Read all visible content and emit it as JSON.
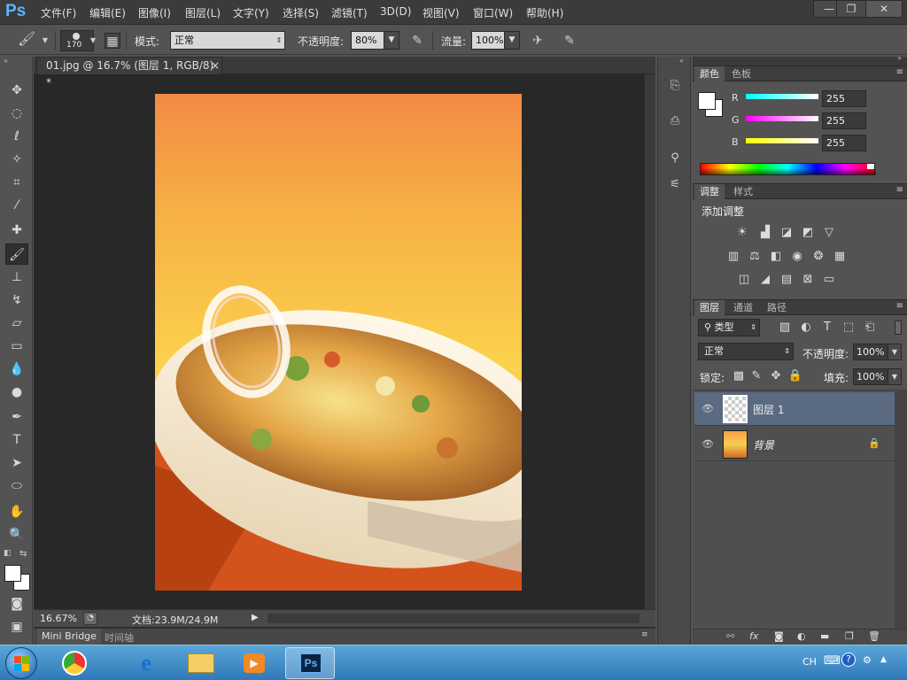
{
  "app": {
    "logo": "Ps"
  },
  "menu": [
    "文件(F)",
    "编辑(E)",
    "图像(I)",
    "图层(L)",
    "文字(Y)",
    "选择(S)",
    "滤镜(T)",
    "3D(D)",
    "视图(V)",
    "窗口(W)",
    "帮助(H)"
  ],
  "window_controls": {
    "minimize": "—",
    "restore": "❐",
    "close": "✕"
  },
  "options": {
    "brush_size": "170",
    "mode_label": "模式:",
    "mode_value": "正常",
    "opacity_label": "不透明度:",
    "opacity_value": "80%",
    "flow_label": "流量:",
    "flow_value": "100%"
  },
  "document": {
    "tab_title": "01.jpg @ 16.7% (图层 1, RGB/8) *",
    "tab_close": "×",
    "zoom": "16.67%",
    "doc_info": "文档:23.9M/24.9M"
  },
  "bottom_tabs": [
    "Mini Bridge",
    "时间轴"
  ],
  "color_panel": {
    "tabs": [
      "颜色",
      "色板"
    ],
    "channels": [
      {
        "label": "R",
        "value": "255"
      },
      {
        "label": "G",
        "value": "255"
      },
      {
        "label": "B",
        "value": "255"
      }
    ]
  },
  "adjust_panel": {
    "tabs": [
      "调整",
      "样式"
    ],
    "title": "添加调整"
  },
  "layers_panel": {
    "tabs": [
      "图层",
      "通道",
      "路径"
    ],
    "filter_label": "类型",
    "blend_mode": "正常",
    "opacity_label": "不透明度:",
    "opacity_value": "100%",
    "lock_label": "锁定:",
    "fill_label": "填充:",
    "fill_value": "100%",
    "layers": [
      {
        "name": "图层 1",
        "selected": true
      },
      {
        "name": "背景",
        "selected": false
      }
    ]
  },
  "taskbar": {
    "lang": "CH"
  },
  "colors": {
    "accent": "#5fb3ff",
    "selected_layer": "#5a6a80"
  }
}
